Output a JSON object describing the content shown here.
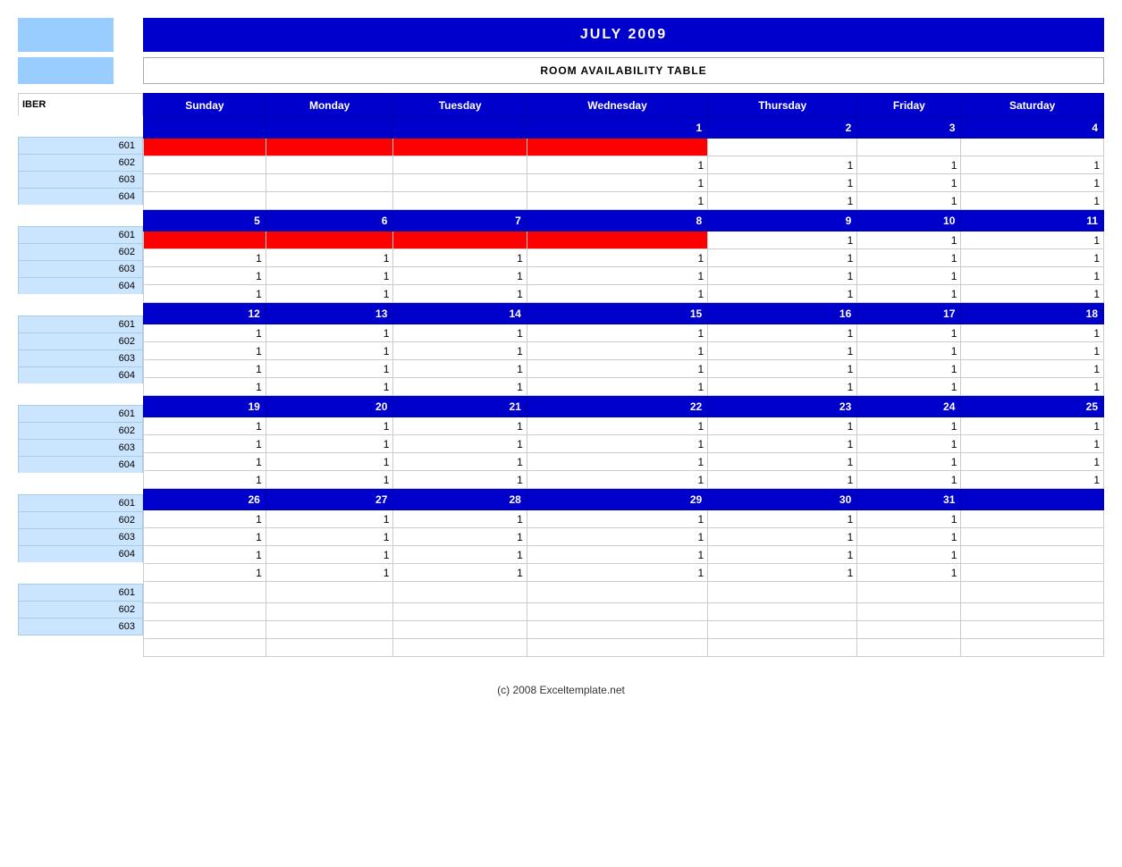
{
  "title": "JULY 2009",
  "subtitle": "ROOM AVAILABILITY TABLE",
  "footer": "(c) 2008 Exceltemplate.net",
  "header_label": "IBER",
  "days": [
    "Sunday",
    "Monday",
    "Tuesday",
    "Wednesday",
    "Thursday",
    "Friday",
    "Saturday"
  ],
  "weeks": [
    {
      "dates": [
        "",
        "",
        "",
        "1",
        "2",
        "3",
        "4"
      ],
      "rooms": [
        {
          "id": "601",
          "values": [
            "",
            "",
            "",
            "",
            "",
            "",
            ""
          ],
          "red": [
            0,
            1,
            2,
            3
          ],
          "show_vals": [
            false,
            false,
            false,
            false,
            false,
            false,
            false
          ]
        },
        {
          "id": "602",
          "values": [
            "",
            "",
            "",
            "1",
            "1",
            "1",
            "1"
          ],
          "red": [],
          "show_vals": [
            false,
            false,
            false,
            true,
            true,
            true,
            true
          ]
        },
        {
          "id": "603",
          "values": [
            "",
            "",
            "",
            "1",
            "1",
            "1",
            "1"
          ],
          "red": [],
          "show_vals": [
            false,
            false,
            false,
            true,
            true,
            true,
            true
          ]
        },
        {
          "id": "604",
          "values": [
            "",
            "",
            "",
            "1",
            "1",
            "1",
            "1"
          ],
          "red": [],
          "show_vals": [
            false,
            false,
            false,
            true,
            true,
            true,
            true
          ]
        }
      ]
    },
    {
      "dates": [
        "5",
        "6",
        "7",
        "8",
        "9",
        "10",
        "11"
      ],
      "rooms": [
        {
          "id": "601",
          "values": [
            "",
            "",
            "",
            "",
            "1",
            "1",
            "1"
          ],
          "red": [
            0,
            1,
            2,
            3
          ],
          "show_vals": [
            false,
            false,
            false,
            false,
            true,
            true,
            true
          ]
        },
        {
          "id": "602",
          "values": [
            "1",
            "1",
            "1",
            "1",
            "1",
            "1",
            "1"
          ],
          "red": [],
          "show_vals": [
            true,
            true,
            true,
            true,
            true,
            true,
            true
          ]
        },
        {
          "id": "603",
          "values": [
            "1",
            "1",
            "1",
            "1",
            "1",
            "1",
            "1"
          ],
          "red": [],
          "show_vals": [
            true,
            true,
            true,
            true,
            true,
            true,
            true
          ]
        },
        {
          "id": "604",
          "values": [
            "1",
            "1",
            "1",
            "1",
            "1",
            "1",
            "1"
          ],
          "red": [],
          "show_vals": [
            true,
            true,
            true,
            true,
            true,
            true,
            true
          ]
        }
      ]
    },
    {
      "dates": [
        "12",
        "13",
        "14",
        "15",
        "16",
        "17",
        "18"
      ],
      "rooms": [
        {
          "id": "601",
          "values": [
            "1",
            "1",
            "1",
            "1",
            "1",
            "1",
            "1"
          ],
          "red": [],
          "show_vals": [
            true,
            true,
            true,
            true,
            true,
            true,
            true
          ]
        },
        {
          "id": "602",
          "values": [
            "1",
            "1",
            "1",
            "1",
            "1",
            "1",
            "1"
          ],
          "red": [],
          "show_vals": [
            true,
            true,
            true,
            true,
            true,
            true,
            true
          ]
        },
        {
          "id": "603",
          "values": [
            "1",
            "1",
            "1",
            "1",
            "1",
            "1",
            "1"
          ],
          "red": [],
          "show_vals": [
            true,
            true,
            true,
            true,
            true,
            true,
            true
          ]
        },
        {
          "id": "604",
          "values": [
            "1",
            "1",
            "1",
            "1",
            "1",
            "1",
            "1"
          ],
          "red": [],
          "show_vals": [
            true,
            true,
            true,
            true,
            true,
            true,
            true
          ]
        }
      ]
    },
    {
      "dates": [
        "19",
        "20",
        "21",
        "22",
        "23",
        "24",
        "25"
      ],
      "rooms": [
        {
          "id": "601",
          "values": [
            "1",
            "1",
            "1",
            "1",
            "1",
            "1",
            "1"
          ],
          "red": [],
          "show_vals": [
            true,
            true,
            true,
            true,
            true,
            true,
            true
          ]
        },
        {
          "id": "602",
          "values": [
            "1",
            "1",
            "1",
            "1",
            "1",
            "1",
            "1"
          ],
          "red": [],
          "show_vals": [
            true,
            true,
            true,
            true,
            true,
            true,
            true
          ]
        },
        {
          "id": "603",
          "values": [
            "1",
            "1",
            "1",
            "1",
            "1",
            "1",
            "1"
          ],
          "red": [],
          "show_vals": [
            true,
            true,
            true,
            true,
            true,
            true,
            true
          ]
        },
        {
          "id": "604",
          "values": [
            "1",
            "1",
            "1",
            "1",
            "1",
            "1",
            "1"
          ],
          "red": [],
          "show_vals": [
            true,
            true,
            true,
            true,
            true,
            true,
            true
          ]
        }
      ]
    },
    {
      "dates": [
        "26",
        "27",
        "28",
        "29",
        "30",
        "31",
        ""
      ],
      "rooms": [
        {
          "id": "601",
          "values": [
            "1",
            "1",
            "1",
            "1",
            "1",
            "1",
            ""
          ],
          "red": [],
          "show_vals": [
            true,
            true,
            true,
            true,
            true,
            true,
            false
          ]
        },
        {
          "id": "602",
          "values": [
            "1",
            "1",
            "1",
            "1",
            "1",
            "1",
            ""
          ],
          "red": [],
          "show_vals": [
            true,
            true,
            true,
            true,
            true,
            true,
            false
          ]
        },
        {
          "id": "603",
          "values": [
            "1",
            "1",
            "1",
            "1",
            "1",
            "1",
            ""
          ],
          "red": [],
          "show_vals": [
            true,
            true,
            true,
            true,
            true,
            true,
            false
          ]
        },
        {
          "id": "604",
          "values": [
            "1",
            "1",
            "1",
            "1",
            "1",
            "1",
            ""
          ],
          "red": [],
          "show_vals": [
            true,
            true,
            true,
            true,
            true,
            true,
            false
          ]
        }
      ]
    }
  ],
  "extra_rows": [
    {
      "id": "601"
    },
    {
      "id": "602"
    },
    {
      "id": "603"
    }
  ]
}
